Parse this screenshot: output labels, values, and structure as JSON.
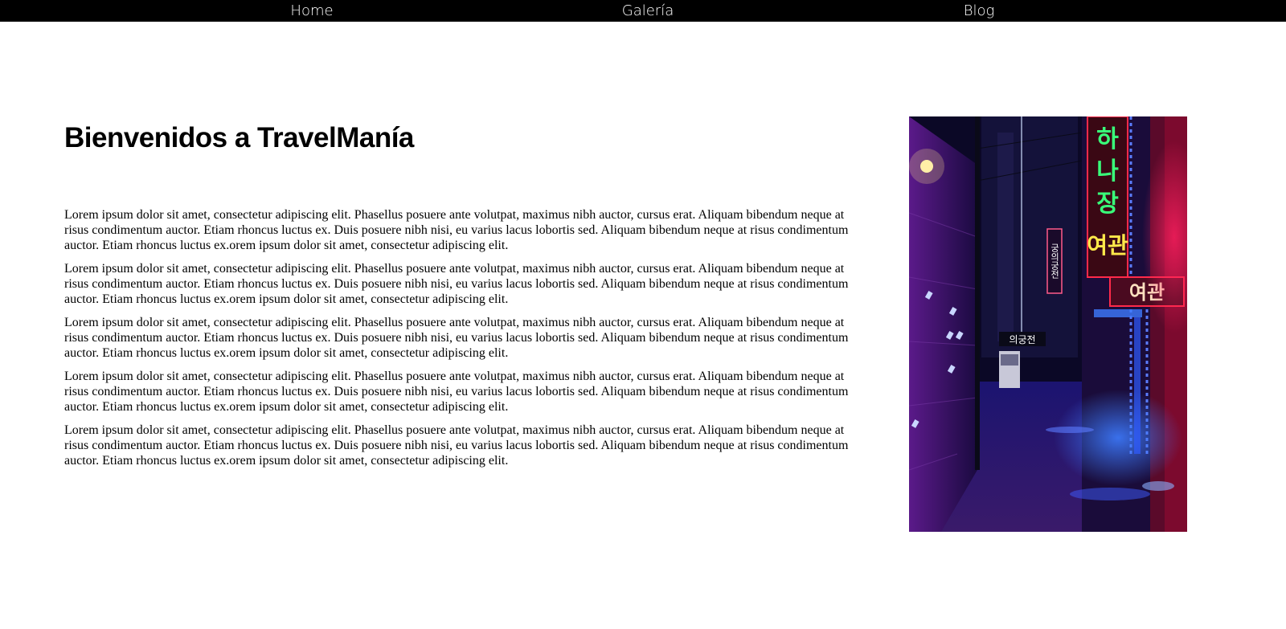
{
  "nav": {
    "items": [
      {
        "label": "Home"
      },
      {
        "label": "Galería"
      },
      {
        "label": "Blog"
      }
    ]
  },
  "main": {
    "title": "Bienvenidos a TravelManía",
    "paragraphs": [
      "Lorem ipsum dolor sit amet, consectetur adipiscing elit. Phasellus posuere ante volutpat, maximus nibh auctor, cursus erat. Aliquam bibendum neque at risus condimentum auctor. Etiam rhoncus luctus ex. Duis posuere nibh nisi, eu varius lacus lobortis sed. Aliquam bibendum neque at risus condimentum auctor. Etiam rhoncus luctus ex.orem ipsum dolor sit amet, consectetur adipiscing elit.",
      "Lorem ipsum dolor sit amet, consectetur adipiscing elit. Phasellus posuere ante volutpat, maximus nibh auctor, cursus erat. Aliquam bibendum neque at risus condimentum auctor. Etiam rhoncus luctus ex. Duis posuere nibh nisi, eu varius lacus lobortis sed. Aliquam bibendum neque at risus condimentum auctor. Etiam rhoncus luctus ex.orem ipsum dolor sit amet, consectetur adipiscing elit.",
      "Lorem ipsum dolor sit amet, consectetur adipiscing elit. Phasellus posuere ante volutpat, maximus nibh auctor, cursus erat. Aliquam bibendum neque at risus condimentum auctor. Etiam rhoncus luctus ex. Duis posuere nibh nisi, eu varius lacus lobortis sed. Aliquam bibendum neque at risus condimentum auctor. Etiam rhoncus luctus ex.orem ipsum dolor sit amet, consectetur adipiscing elit.",
      "Lorem ipsum dolor sit amet, consectetur adipiscing elit. Phasellus posuere ante volutpat, maximus nibh auctor, cursus erat. Aliquam bibendum neque at risus condimentum auctor. Etiam rhoncus luctus ex. Duis posuere nibh nisi, eu varius lacus lobortis sed. Aliquam bibendum neque at risus condimentum auctor. Etiam rhoncus luctus ex.orem ipsum dolor sit amet, consectetur adipiscing elit.",
      "Lorem ipsum dolor sit amet, consectetur adipiscing elit. Phasellus posuere ante volutpat, maximus nibh auctor, cursus erat. Aliquam bibendum neque at risus condimentum auctor. Etiam rhoncus luctus ex. Duis posuere nibh nisi, eu varius lacus lobortis sed. Aliquam bibendum neque at risus condimentum auctor. Etiam rhoncus luctus ex.orem ipsum dolor sit amet, consectetur adipiscing elit."
    ]
  },
  "image": {
    "signs": [
      "하",
      "나",
      "장",
      "여관",
      "여관",
      "궁의궁전",
      "의궁전"
    ]
  },
  "colors": {
    "navbar": "#000000",
    "neon_green": "#39ff7a",
    "neon_red": "#ff2a4a",
    "neon_blue": "#2f5bff",
    "neon_yellow": "#ffe94a"
  }
}
